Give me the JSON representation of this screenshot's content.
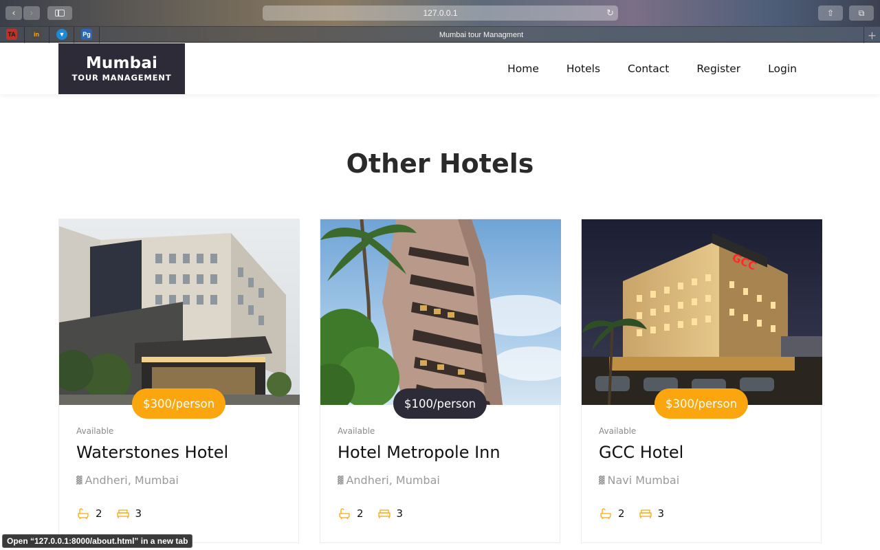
{
  "browser": {
    "url": "127.0.0.1",
    "tab_title": "Mumbai tour Managment",
    "status_link": "Open “127.0.0.1:8000/about.html” in a new tab",
    "bookmarks": [
      {
        "name": "bookmark-1",
        "label": "TA",
        "bg": "#c0312a",
        "fg": "#1b1b1b"
      },
      {
        "name": "bookmark-2",
        "label": "in",
        "bg": "#4a4a4a",
        "fg": "#f5a623"
      },
      {
        "name": "bookmark-3",
        "label": "▼",
        "bg": "#1c8ad6",
        "fg": "#ffffff"
      },
      {
        "name": "bookmark-4",
        "label": "Pg",
        "bg": "#2b67b5",
        "fg": "#ffffff"
      }
    ]
  },
  "header": {
    "logo_main": "Mumbai",
    "logo_sub": "TOUR MANAGEMENT",
    "nav": [
      "Home",
      "Hotels",
      "Contact",
      "Register",
      "Login"
    ]
  },
  "section": {
    "title": "Other Hotels"
  },
  "colors": {
    "accent": "#fca60f",
    "dark": "#2d2b37"
  },
  "hotels": [
    {
      "name": "Waterstones Hotel",
      "price": "$300/person",
      "status": "Available",
      "location": "Andheri, Mumbai",
      "baths": "2",
      "beds": "3",
      "badge_color": "#fca60f"
    },
    {
      "name": "Hotel Metropole Inn",
      "price": "$100/person",
      "status": "Available",
      "location": "Andheri, Mumbai",
      "baths": "2",
      "beds": "3",
      "badge_color": "#2d2b37"
    },
    {
      "name": "GCC Hotel",
      "price": "$300/person",
      "status": "Available",
      "location": "Navi Mumbai",
      "baths": "2",
      "beds": "3",
      "badge_color": "#fca60f"
    }
  ]
}
